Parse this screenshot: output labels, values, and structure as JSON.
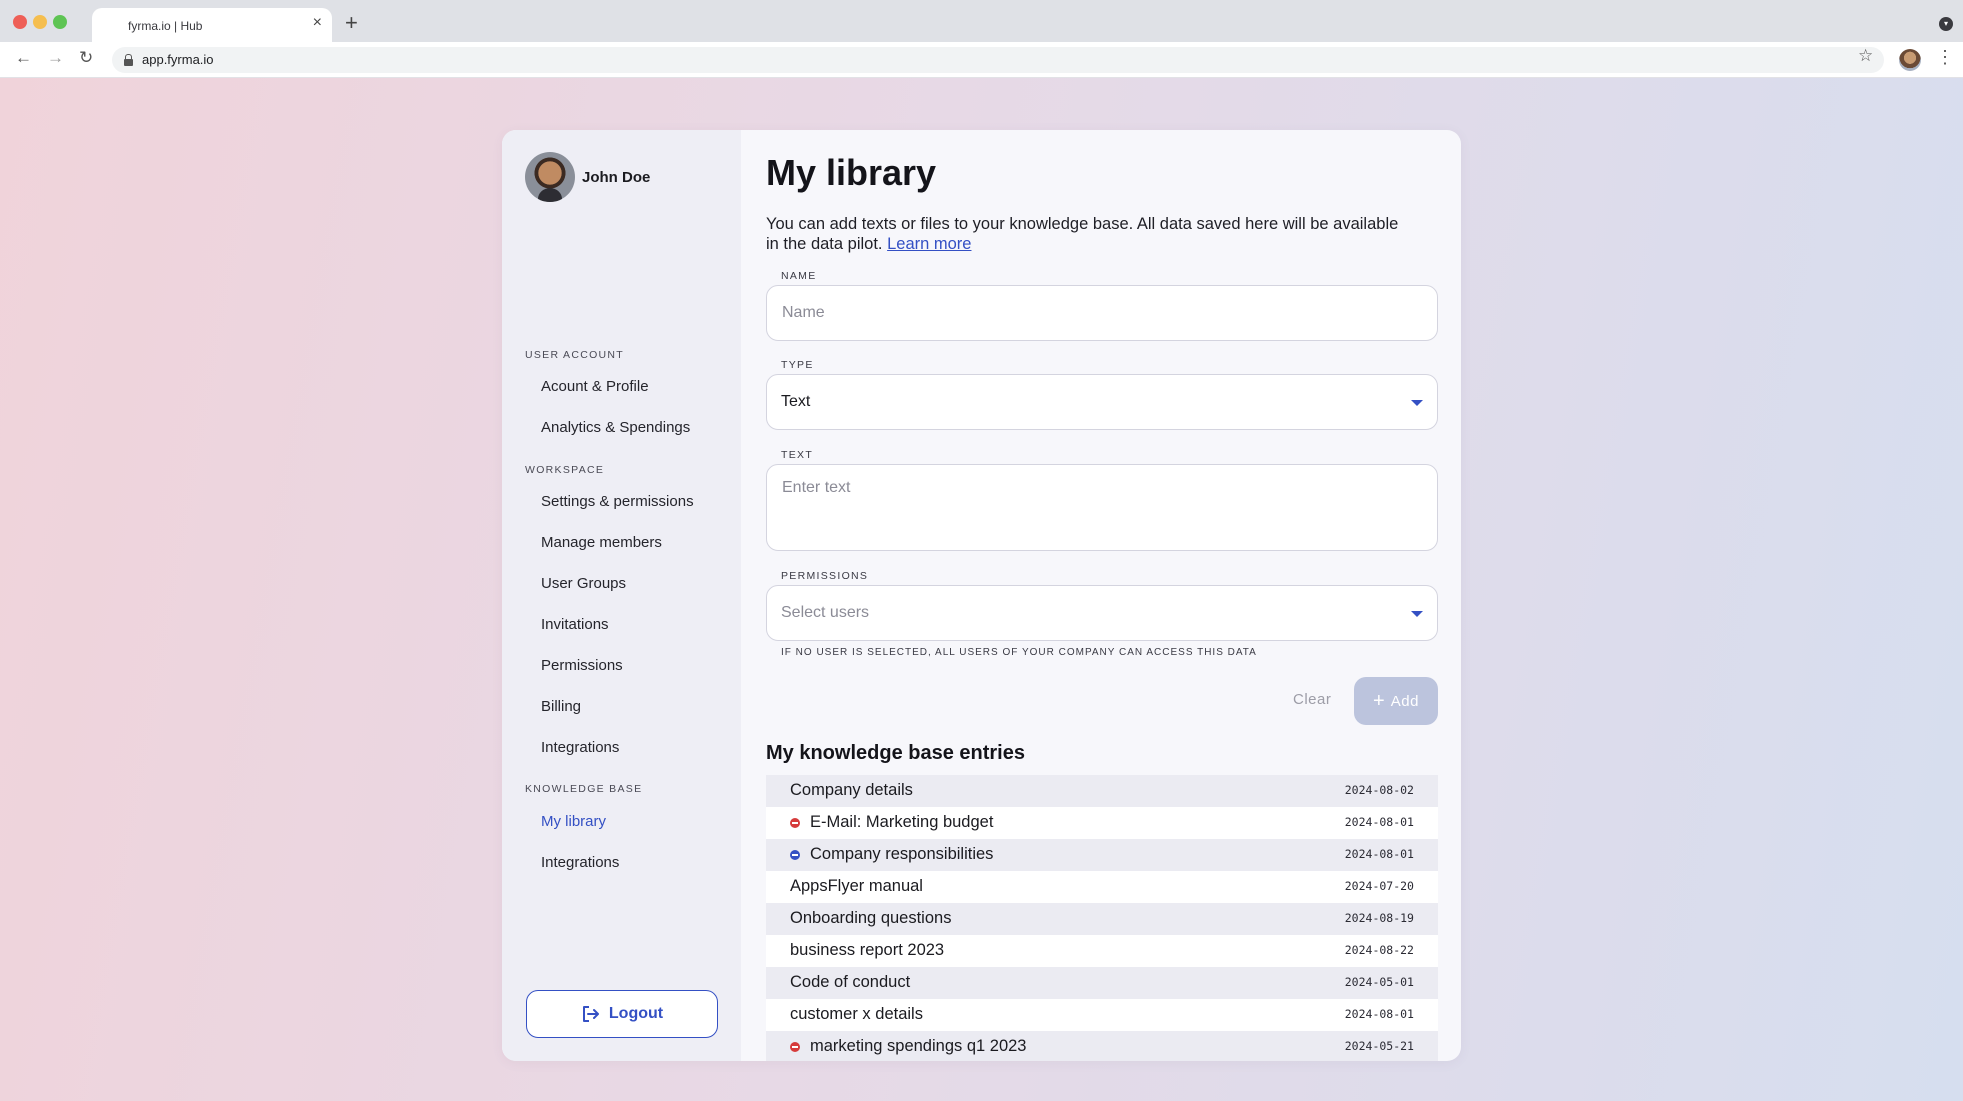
{
  "browser": {
    "tab_title": "fyrma.io | Hub",
    "url": "app.fyrma.io"
  },
  "sidebar": {
    "user_name": "John Doe",
    "sections": [
      {
        "label": "USER ACCOUNT",
        "items": [
          "Acount & Profile",
          "Analytics & Spendings"
        ]
      },
      {
        "label": "WORKSPACE",
        "items": [
          "Settings & permissions",
          "Manage members",
          "User Groups",
          "Invitations",
          "Permissions",
          "Billing",
          "Integrations"
        ]
      },
      {
        "label": "KNOWLEDGE BASE",
        "items": [
          "My library",
          "Integrations"
        ]
      }
    ],
    "active_item": "My library",
    "logout_label": "Logout"
  },
  "main": {
    "title": "My library",
    "intro": "You can add texts or files to your knowledge base. All data saved here will be available in the data pilot.",
    "learn_more": "Learn more",
    "form": {
      "name_label": "NAME",
      "name_placeholder": "Name",
      "type_label": "TYPE",
      "type_value": "Text",
      "text_label": "TEXT",
      "text_placeholder": "Enter text",
      "permissions_label": "PERMISSIONS",
      "permissions_placeholder": "Select users",
      "permissions_hint": "IF NO USER IS SELECTED, ALL USERS OF YOUR COMPANY CAN ACCESS THIS DATA",
      "clear_label": "Clear",
      "add_label": "Add"
    },
    "entries_title": "My knowledge base entries",
    "entries": [
      {
        "name": "Company details",
        "date": "2024-08-02",
        "status": null
      },
      {
        "name": "E-Mail: Marketing budget",
        "date": "2024-08-01",
        "status": "error"
      },
      {
        "name": "Company responsibilities",
        "date": "2024-08-01",
        "status": "pending"
      },
      {
        "name": "AppsFlyer manual",
        "date": "2024-07-20",
        "status": null
      },
      {
        "name": "Onboarding questions",
        "date": "2024-08-19",
        "status": null
      },
      {
        "name": "business report 2023",
        "date": "2024-08-22",
        "status": null
      },
      {
        "name": "Code of conduct",
        "date": "2024-05-01",
        "status": null
      },
      {
        "name": "customer x details",
        "date": "2024-08-01",
        "status": null
      },
      {
        "name": "marketing spendings q1 2023",
        "date": "2024-05-21",
        "status": "error"
      }
    ]
  },
  "colors": {
    "accent": "#3450c4",
    "error": "#d63b3b",
    "pending": "#3450c4",
    "add_disabled": "#bcc4dd"
  }
}
